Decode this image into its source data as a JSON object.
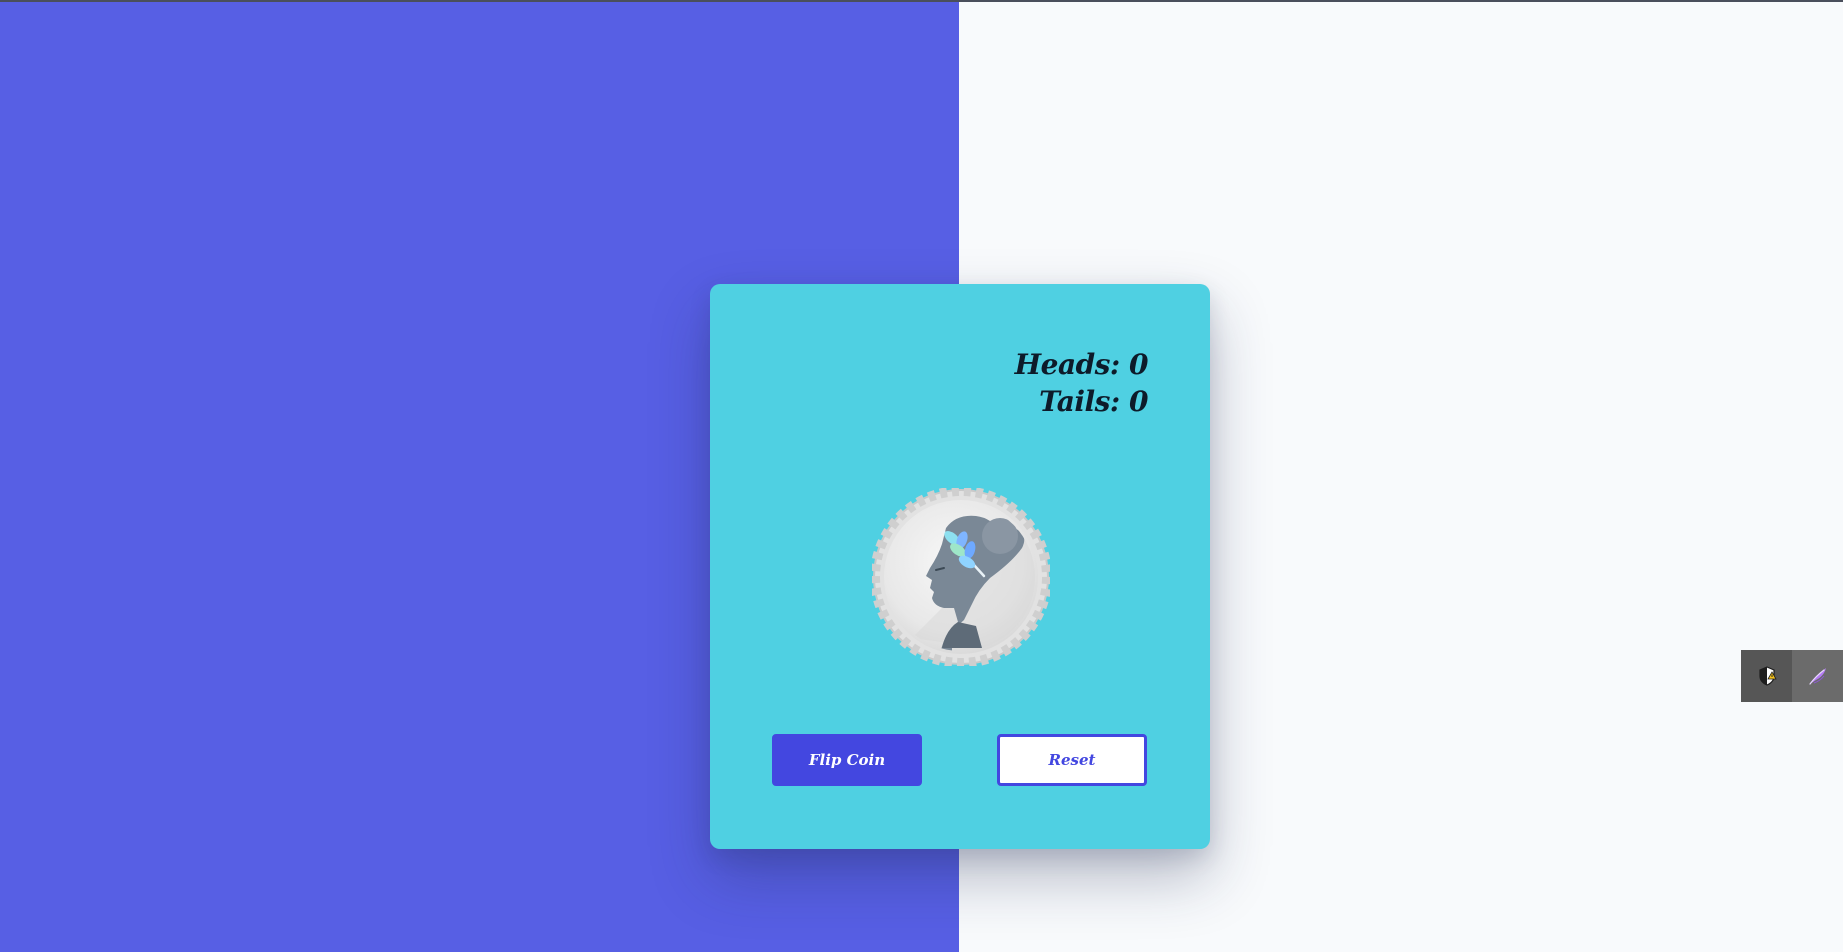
{
  "score": {
    "heads_label": "Heads: 0",
    "tails_label": "Tails: 0"
  },
  "coin": {
    "icon": "coin-profile-icon"
  },
  "buttons": {
    "flip_label": "Flip Coin",
    "reset_label": "Reset"
  },
  "tray": {
    "items": [
      "shield-warning-icon",
      "feather-icon"
    ]
  },
  "colors": {
    "left_background": "#575fe4",
    "right_background": "#f8fafc",
    "card": "#4fd0e2",
    "primary_button": "#4347e0",
    "score_text": "#0d1b2a"
  }
}
